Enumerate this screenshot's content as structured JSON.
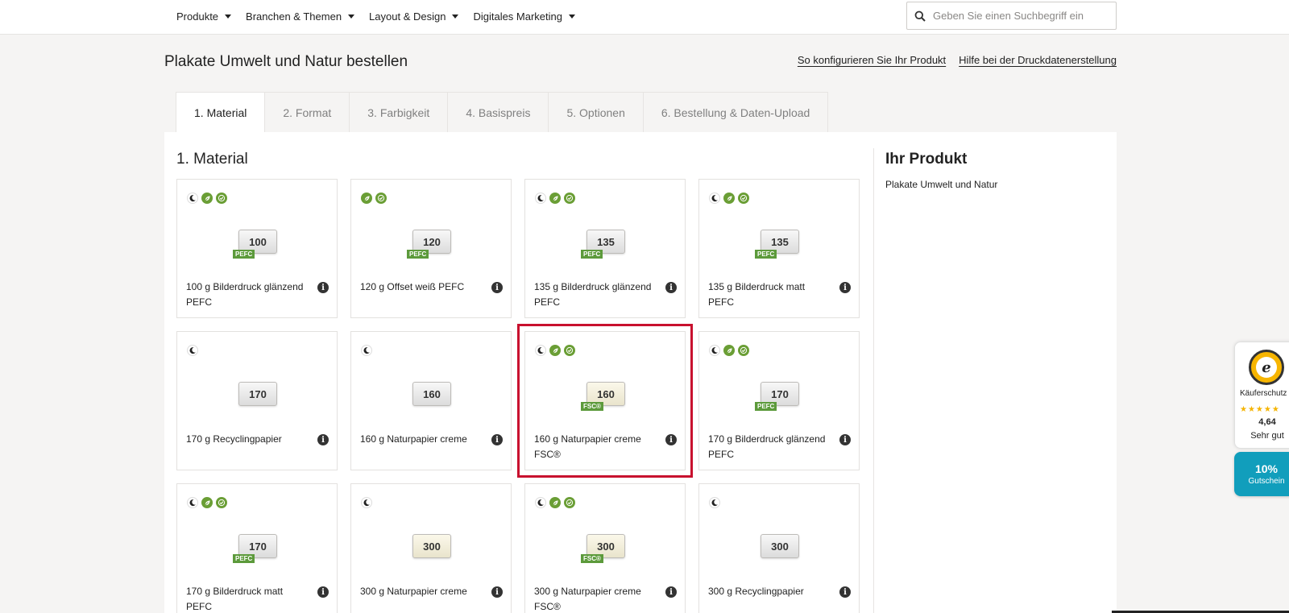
{
  "nav": {
    "items": [
      {
        "label": "Produkte"
      },
      {
        "label": "Branchen & Themen"
      },
      {
        "label": "Layout & Design"
      },
      {
        "label": "Digitales Marketing"
      }
    ],
    "search_placeholder": "Geben Sie einen Suchbegriff ein"
  },
  "header": {
    "title": "Plakate Umwelt und Natur bestellen",
    "link_configure": "So konfigurieren Sie Ihr Produkt",
    "link_help": "Hilfe bei der Druckdatenerstellung"
  },
  "tabs": [
    {
      "label": "1. Material",
      "active": true
    },
    {
      "label": "2. Format"
    },
    {
      "label": "3. Farbigkeit"
    },
    {
      "label": "4. Basispreis"
    },
    {
      "label": "5. Optionen"
    },
    {
      "label": "6. Bestellung & Daten-Upload"
    }
  ],
  "material": {
    "title": "1. Material",
    "selected_index": 6,
    "cards": [
      {
        "weight": "100",
        "cert": "PEFC",
        "label": "100 g Bilderdruck glänzend PEFC",
        "badges": [
          "moon-icon",
          "leaf-icon",
          "check-icon"
        ],
        "paper": "white"
      },
      {
        "weight": "120",
        "cert": "PEFC",
        "label": "120 g Offset weiß PEFC",
        "badges": [
          "leaf-icon",
          "check-icon"
        ],
        "paper": "white"
      },
      {
        "weight": "135",
        "cert": "PEFC",
        "label": "135 g Bilderdruck glänzend PEFC",
        "badges": [
          "moon-icon",
          "leaf-icon",
          "check-icon"
        ],
        "paper": "white"
      },
      {
        "weight": "135",
        "cert": "PEFC",
        "label": "135 g Bilderdruck matt PEFC",
        "badges": [
          "moon-icon",
          "leaf-icon",
          "check-icon"
        ],
        "paper": "white"
      },
      {
        "weight": "170",
        "cert": "",
        "label": "170 g Recyclingpapier",
        "badges": [
          "moon-icon"
        ],
        "paper": "white"
      },
      {
        "weight": "160",
        "cert": "",
        "label": "160 g Naturpapier creme",
        "badges": [
          "moon-icon"
        ],
        "paper": "white"
      },
      {
        "weight": "160",
        "cert": "FSC®",
        "label": "160 g Naturpapier creme FSC®",
        "badges": [
          "moon-icon",
          "leaf-icon",
          "check-icon"
        ],
        "paper": "cream"
      },
      {
        "weight": "170",
        "cert": "PEFC",
        "label": "170 g Bilderdruck glänzend PEFC",
        "badges": [
          "moon-icon",
          "leaf-icon",
          "check-icon"
        ],
        "paper": "white"
      },
      {
        "weight": "170",
        "cert": "PEFC",
        "label": "170 g Bilderdruck matt PEFC",
        "badges": [
          "moon-icon",
          "leaf-icon",
          "check-icon"
        ],
        "paper": "white"
      },
      {
        "weight": "300",
        "cert": "",
        "label": "300 g Naturpapier creme",
        "badges": [
          "moon-icon"
        ],
        "paper": "cream"
      },
      {
        "weight": "300",
        "cert": "FSC®",
        "label": "300 g Naturpapier creme FSC®",
        "badges": [
          "moon-icon",
          "leaf-icon",
          "check-icon"
        ],
        "paper": "cream"
      },
      {
        "weight": "300",
        "cert": "",
        "label": "300 g Recyclingpapier",
        "badges": [
          "moon-icon"
        ],
        "paper": "white"
      }
    ]
  },
  "sidebar": {
    "title": "Ihr Produkt",
    "product": "Plakate Umwelt und Natur"
  },
  "trusted_shops": {
    "seal_letter": "e",
    "label": "Käuferschutz",
    "stars": "★★★★★",
    "score": "4,64",
    "rating": "Sehr gut"
  },
  "coupon": {
    "percent": "10%",
    "text": "Gutschein"
  },
  "colors": {
    "accent_green": "#6a9e35",
    "selected_outline": "#c8102e",
    "coupon_blue": "#119ebc"
  }
}
